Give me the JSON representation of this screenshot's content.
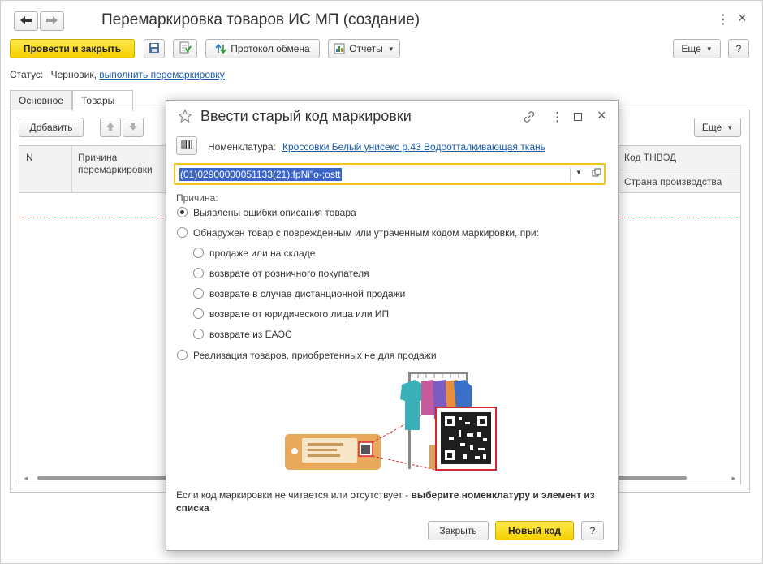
{
  "window": {
    "title": "Перемаркировка товаров ИС МП (создание)",
    "more_menu_glyph": "⋮",
    "close_glyph": "×",
    "back_icon": "arrow-left-icon",
    "forward_icon": "arrow-right-icon"
  },
  "toolbar": {
    "post_close_label": "Провести и закрыть",
    "exchange_protocol_label": "Протокол обмена",
    "reports_label": "Отчеты",
    "more_label": "Еще",
    "help_label": "?"
  },
  "status": {
    "label": "Статус:",
    "value": "Черновик,",
    "action_link": "выполнить перемаркировку"
  },
  "tabs": [
    {
      "label": "Основное",
      "active": false
    },
    {
      "label": "Товары",
      "active": true
    }
  ],
  "goods": {
    "add_label": "Добавить",
    "more_label": "Еще",
    "columns": {
      "n": "N",
      "reason": "Причина перемаркировки",
      "tnved": "Код ТНВЭД",
      "country": "Страна производства"
    }
  },
  "dialog": {
    "title": "Ввести старый код маркировки",
    "nomenclature_label": "Номенклатура:",
    "nomenclature_value": "Кроссовки Белый унисекс р.43 Водоотталкивающая ткань",
    "code_value": "(01)02900000051133(21):fpNi\"o-;ostt",
    "reason_label": "Причина:",
    "reasons": [
      {
        "label": "Выявлены ошибки описания товара",
        "selected": true
      },
      {
        "label": "Обнаружен товар с поврежденным или утраченным кодом маркировки, при:",
        "selected": false
      }
    ],
    "sub_reasons": [
      {
        "label": "продаже или на складе",
        "selected": false
      },
      {
        "label": "возврате от розничного покупателя",
        "selected": false
      },
      {
        "label": "возврате в случае дистанционной продажи",
        "selected": false
      },
      {
        "label": "возврате от юридического лица или ИП",
        "selected": false
      },
      {
        "label": "возврате из ЕАЭС",
        "selected": false
      }
    ],
    "other_reason": {
      "label": "Реализация товаров, приобретенных не для продажи",
      "selected": false
    },
    "hint_normal": "Если код маркировки не читается или отсутствует - ",
    "hint_bold": "выберите номенклатуру и элемент из списка",
    "close_label": "Закрыть",
    "new_code_label": "Новый код",
    "help_label": "?"
  },
  "colors": {
    "accent_yellow": "#f5d000",
    "link_blue": "#1a5aa8",
    "input_border": "#f0c419",
    "selection_blue": "#3b64c8",
    "qr_red": "#d9262c",
    "tag_orange": "#e8a95a"
  }
}
